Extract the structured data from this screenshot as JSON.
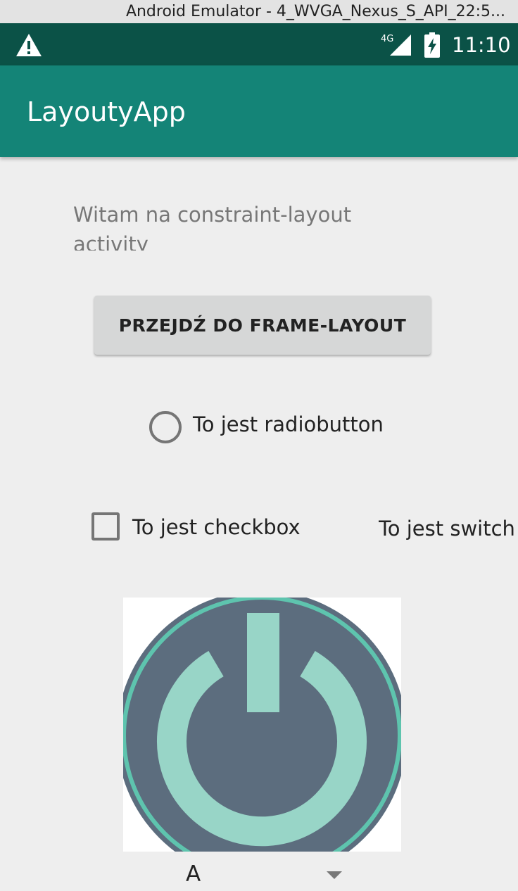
{
  "window": {
    "title": "Android Emulator - 4_WVGA_Nexus_S_API_22:5..."
  },
  "status_bar": {
    "warning_icon": "warning-icon",
    "network_label": "4G",
    "signal_icon": "cell-signal-icon",
    "battery_icon": "battery-charging-icon",
    "time": "11:10"
  },
  "app_bar": {
    "title": "LayoutyApp",
    "color": "#148477"
  },
  "content": {
    "welcome_text": "Witam na constraint-layout activity",
    "frame_button_label": "PRZEJDŹ DO FRAME-LAYOUT",
    "radio_label": "To jest radiobutton",
    "radio_checked": false,
    "checkbox_label": "To jest checkbox",
    "checkbox_checked": false,
    "switch_label": "To jest switch",
    "image_icon": "power-icon",
    "spinner_value": "A"
  },
  "colors": {
    "status_bar": "#0b5247",
    "accent": "#5ec4ae",
    "power_fg": "#98d5c7",
    "power_bg": "#5c6d7e"
  }
}
